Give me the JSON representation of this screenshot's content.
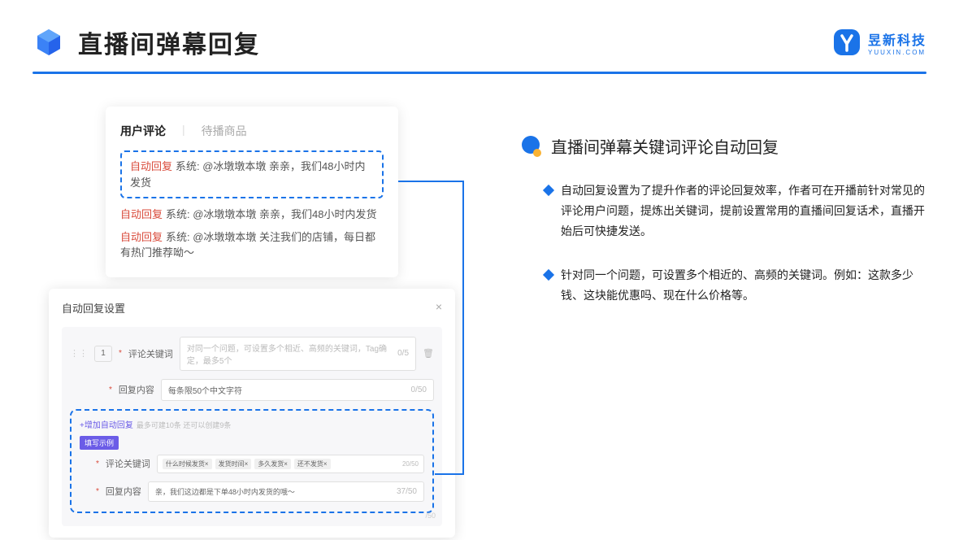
{
  "header": {
    "title": "直播间弹幕回复",
    "brand_name": "昱新科技",
    "brand_url": "YUUXIN.COM"
  },
  "card1": {
    "tab_active": "用户评论",
    "tab_inactive": "待播商品",
    "auto_tag": "自动回复",
    "msg1": "系统: @冰墩墩本墩 亲亲，我们48小时内发货",
    "msg2": "系统: @冰墩墩本墩 亲亲，我们48小时内发货",
    "msg3": "系统: @冰墩墩本墩 关注我们的店铺，每日都有热门推荐呦～"
  },
  "card2": {
    "title": "自动回复设置",
    "num": "1",
    "label_kw": "评论关键词",
    "placeholder_kw": "对同一个问题，可设置多个相近、高频的关键词，Tag确定，最多5个",
    "count_kw": "0/5",
    "label_reply": "回复内容",
    "placeholder_reply": "每条限50个中文字符",
    "count_reply": "0/50",
    "add_link": "+增加自动回复",
    "add_hint": "最多可建10条 还可以创建9条",
    "badge": "填写示例",
    "ex_tags": [
      "什么时候发货×",
      "发货时间×",
      "多久发货×",
      "还不发货×"
    ],
    "ex_tag_count": "20/50",
    "ex_reply": "亲，我们这边都是下单48小时内发货的哦～",
    "ex_reply_count": "37/50",
    "faded": "/50"
  },
  "right": {
    "subtitle": "直播间弹幕关键词评论自动回复",
    "b1": "自动回复设置为了提升作者的评论回复效率，作者可在开播前针对常见的评论用户问题，提炼出关键词，提前设置常用的直播间回复话术，直播开始后可快捷发送。",
    "b2": "针对同一个问题，可设置多个相近的、高频的关键词。例如：这款多少钱、这块能优惠吗、现在什么价格等。"
  }
}
